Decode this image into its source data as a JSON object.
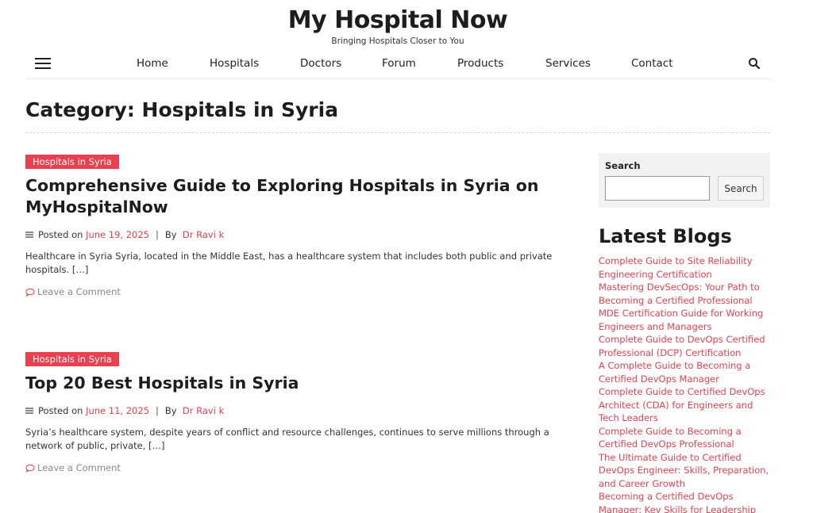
{
  "site": {
    "title": "My Hospital Now",
    "tagline": "Bringing Hospitals Closer to You"
  },
  "nav": {
    "items": [
      "Home",
      "Hospitals",
      "Doctors",
      "Forum",
      "Products",
      "Services",
      "Contact"
    ]
  },
  "page": {
    "title": "Category: Hospitals in Syria"
  },
  "posts": [
    {
      "category": "Hospitals in Syria",
      "title": "Comprehensive Guide to Exploring Hospitals in Syria on MyHospitalNow",
      "posted_on": "Posted on",
      "date": "June 19, 2025",
      "by": "By",
      "author": "Dr Ravi k",
      "excerpt": "Healthcare in Syria Syria, located in the Middle East, has a healthcare system that includes both public and private hospitals. […]",
      "comment": "Leave a Comment"
    },
    {
      "category": "Hospitals in Syria",
      "title": "Top 20 Best Hospitals in Syria",
      "posted_on": "Posted on",
      "date": "June 11, 2025",
      "by": "By",
      "author": "Dr Ravi k",
      "excerpt": "Syria’s healthcare system, despite years of conflict and resource challenges, continues to serve millions through a network of public, private, […]",
      "comment": "Leave a Comment"
    }
  ],
  "sidebar": {
    "search_label": "Search",
    "search_value": "",
    "search_button": "Search",
    "latest_title": "Latest Blogs",
    "blogs": [
      "Complete Guide to Site Reliability Engineering Certification",
      "Mastering DevSecOps: Your Path to Becoming a Certified Professional",
      "MDE Certification Guide for Working Engineers and Managers",
      "Complete Guide to DevOps Certified Professional (DCP) Certification",
      "A Complete Guide to Becoming a Certified DevOps Manager",
      "Complete Guide to Certified DevOps Architect (CDA) for Engineers and Tech Leaders",
      "Complete Guide to Becoming a Certified DevOps Professional",
      "The Ultimate Guide to Certified DevOps Engineer: Skills, Preparation, and Career Growth",
      "Becoming a Certified DevOps Manager: Key Skills for Leadership"
    ]
  },
  "colors": {
    "accent": "#e8404f",
    "text": "#1d1d1d",
    "muted": "#888888"
  }
}
